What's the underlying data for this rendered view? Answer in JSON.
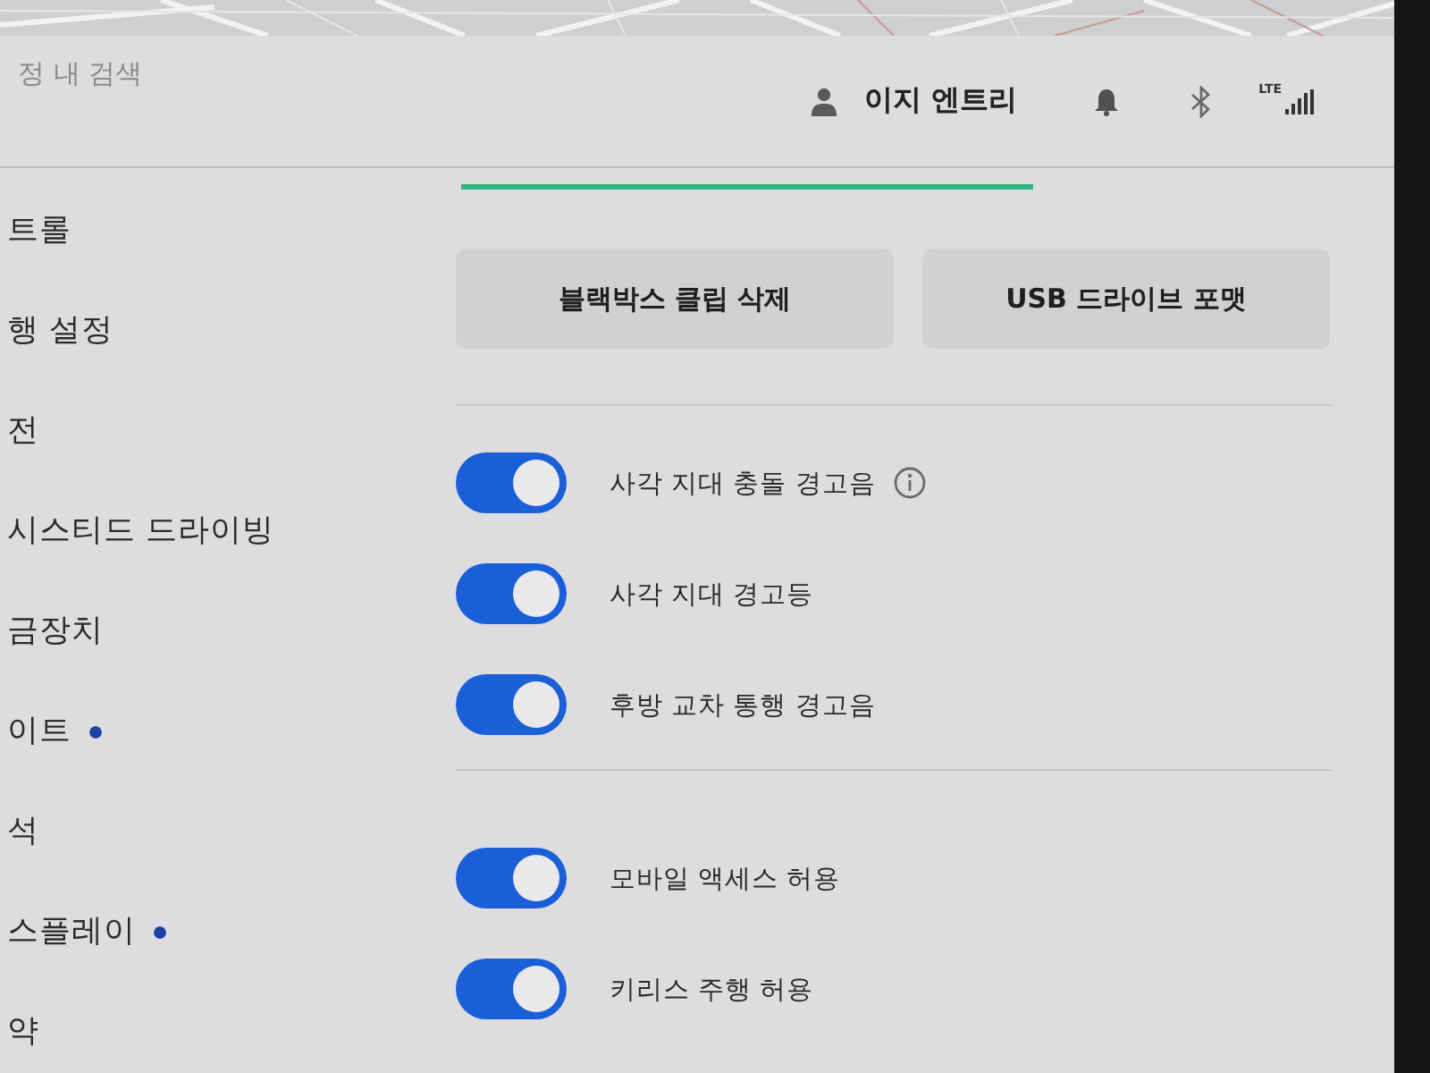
{
  "header": {
    "search": {
      "placeholder": "정 내 검색"
    },
    "profile": {
      "name": "이지 엔트리"
    },
    "network": {
      "label": "LTE"
    }
  },
  "sidebar": {
    "items": [
      {
        "label": "트롤",
        "dot": false
      },
      {
        "label": "행 설정",
        "dot": false
      },
      {
        "label": "전",
        "dot": false
      },
      {
        "label": "시스티드 드라이빙",
        "dot": false
      },
      {
        "label": "금장치",
        "dot": false
      },
      {
        "label": "이트",
        "dot": true
      },
      {
        "label": "석",
        "dot": false
      },
      {
        "label": "스플레이",
        "dot": true
      },
      {
        "label": "약",
        "dot": false
      }
    ]
  },
  "content": {
    "buttons": [
      {
        "label": "블랙박스 클립 삭제"
      },
      {
        "label": "USB 드라이브 포맷"
      }
    ],
    "sections": [
      {
        "toggles": [
          {
            "label": "사각 지대 충돌 경고음",
            "on": true,
            "info": true
          },
          {
            "label": "사각 지대 경고등",
            "on": true,
            "info": false
          },
          {
            "label": "후방 교차 통행 경고음",
            "on": true,
            "info": false
          }
        ]
      },
      {
        "toggles": [
          {
            "label": "모바일 액세스 허용",
            "on": true,
            "info": false
          },
          {
            "label": "키리스 주행 허용",
            "on": true,
            "info": false
          }
        ]
      }
    ]
  }
}
